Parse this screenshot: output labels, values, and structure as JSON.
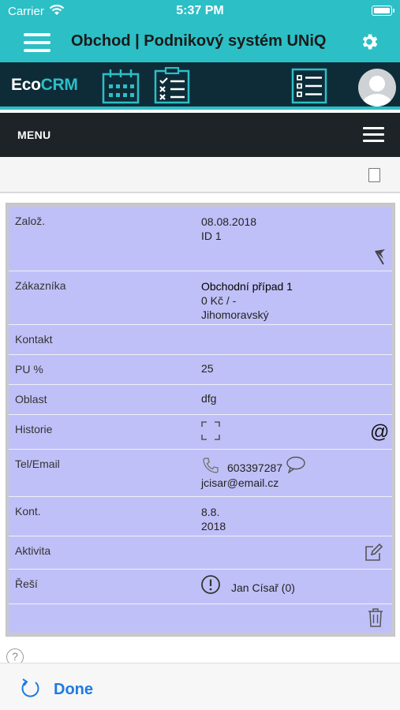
{
  "status_bar": {
    "carrier": "Carrier",
    "time": "5:37 PM"
  },
  "nav": {
    "title": "Obchod | Podnikový systém UNiQ"
  },
  "crm": {
    "logo_eco": "Eco",
    "logo_crm": "CRM"
  },
  "menu": {
    "label": "MENU"
  },
  "rows": {
    "zaloz": {
      "label": "Založ.",
      "date": "08.08.2018",
      "id": "ID 1"
    },
    "zakaznika": {
      "label": "Zákazníka",
      "name": "Obchodní případ 1",
      "amount": "0 Kč / -",
      "region": "Jihomoravský"
    },
    "kontakt": {
      "label": "Kontakt"
    },
    "pu": {
      "label": "PU %",
      "value": "25"
    },
    "oblast": {
      "label": "Oblast",
      "value": "dfg"
    },
    "historie": {
      "label": "Historie"
    },
    "tel": {
      "label": "Tel/Email",
      "phone": "603397287",
      "email": "jcisar@email.cz"
    },
    "kont": {
      "label": "Kont.",
      "day": "8.8.",
      "year": "2018"
    },
    "aktivita": {
      "label": "Aktivita"
    },
    "resi": {
      "label": "Řeší",
      "person": "Jan Císař (0)"
    }
  },
  "bottom": {
    "done_label": "Done",
    "help_glyph": "?"
  },
  "icons": {
    "wifi": "wifi-icon",
    "battery": "battery-icon",
    "menu": "hamburger-icon",
    "settings": "gear-icon",
    "calendar": "calendar-icon",
    "checklist": "checklist-icon",
    "list": "list-icon",
    "avatar": "avatar-icon",
    "flag": "flag-icon",
    "at": "at-sign-icon",
    "phone": "phone-icon",
    "chat": "chat-bubble-icon",
    "edit": "edit-icon",
    "alert": "alert-icon",
    "trash": "trash-icon",
    "refresh": "refresh-icon",
    "scan": "scan-frame-icon",
    "checkbox": "checkbox-icon",
    "help": "help-icon"
  },
  "colors": {
    "accent": "#2cbfc6",
    "header_dark": "#0e2c38",
    "menu_dark": "#1d2326",
    "row_bg": "#c0c0f8",
    "link_blue": "#1e7be0"
  }
}
